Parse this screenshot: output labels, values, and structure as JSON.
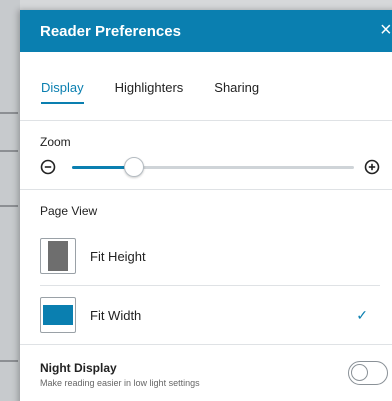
{
  "panel": {
    "title": "Reader Preferences",
    "close_glyph": "×"
  },
  "tabs": [
    {
      "label": "Display",
      "active": true
    },
    {
      "label": "Highlighters",
      "active": false
    },
    {
      "label": "Sharing",
      "active": false
    }
  ],
  "zoom": {
    "label": "Zoom",
    "level_fraction": 0.22,
    "minus_icon": "zoom-out-icon",
    "plus_icon": "zoom-in-icon"
  },
  "page_view": {
    "label": "Page View",
    "options": [
      {
        "label": "Fit Height",
        "selected": false
      },
      {
        "label": "Fit Width",
        "selected": true
      }
    ],
    "check_glyph": "✓"
  },
  "night_display": {
    "title": "Night Display",
    "description": "Make reading easier in low light settings",
    "enabled": false
  },
  "colors": {
    "accent": "#0a7fb0",
    "header_bg": "#0a7fb0"
  }
}
